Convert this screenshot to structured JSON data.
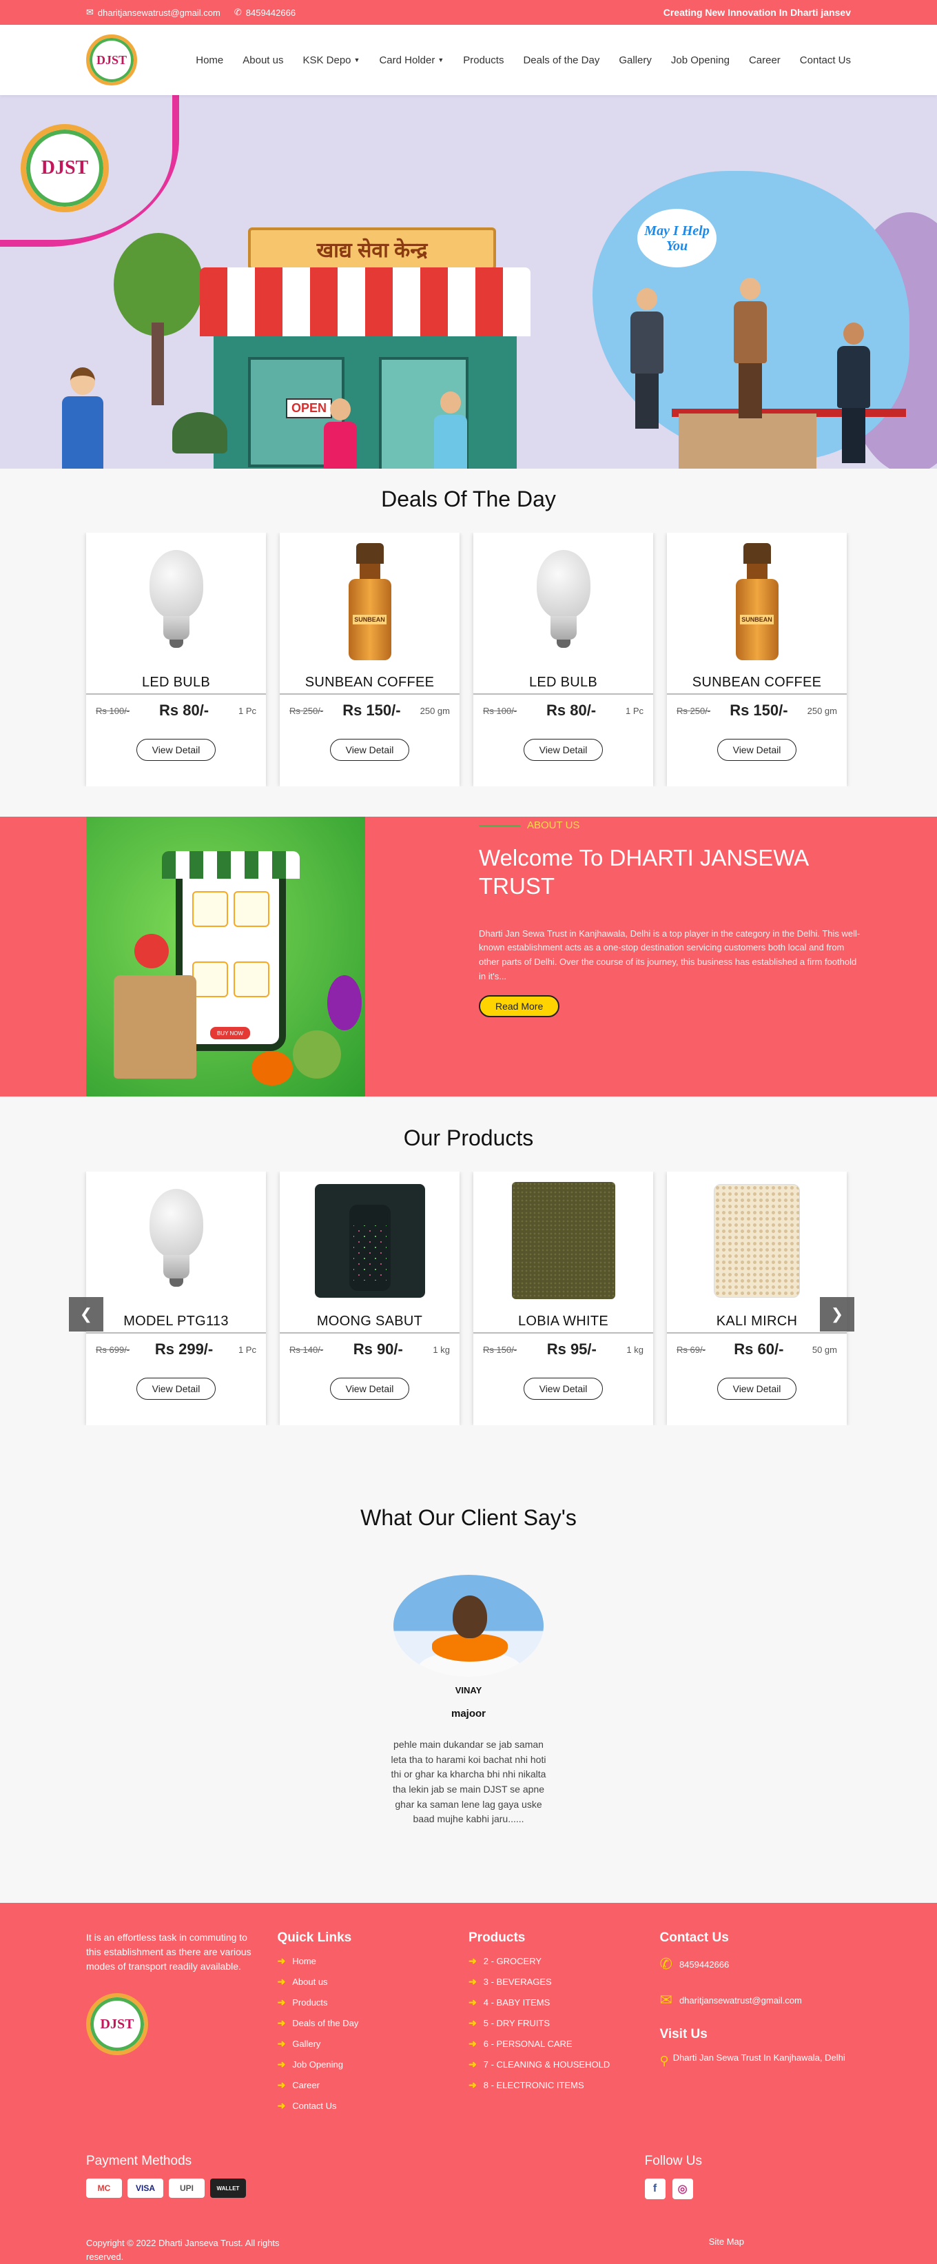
{
  "topbar": {
    "email": "dharitjansewatrust@gmail.com",
    "phone": "8459442666",
    "marquee": "Creating New Innovation In Dharti jansev"
  },
  "brand": {
    "logo_text": "DJST"
  },
  "nav": {
    "items": [
      "Home",
      "About us",
      "KSK Depo",
      "Card Holder",
      "Products",
      "Deals of the Day",
      "Gallery",
      "Job Opening",
      "Career",
      "Contact Us"
    ]
  },
  "hero": {
    "logo_text": "DJST",
    "sign_text": "खाद्य सेवा केन्द्र",
    "bubble_text": "May I Help You",
    "open_sign": "OPEN"
  },
  "deals": {
    "title": "Deals Of The Day",
    "cards": [
      {
        "name": "LED BULB",
        "old_price": "Rs 100/-",
        "price": "Rs 80/-",
        "unit": "1 Pc",
        "button": "View Detail",
        "image": "bulb"
      },
      {
        "name": "SUNBEAN COFFEE",
        "old_price": "Rs 250/-",
        "price": "Rs 150/-",
        "unit": "250 gm",
        "button": "View Detail",
        "image": "bottle"
      },
      {
        "name": "LED BULB",
        "old_price": "Rs 100/-",
        "price": "Rs 80/-",
        "unit": "1 Pc",
        "button": "View Detail",
        "image": "bulb"
      },
      {
        "name": "SUNBEAN COFFEE",
        "old_price": "Rs 250/-",
        "price": "Rs 150/-",
        "unit": "250 gm",
        "button": "View Detail",
        "image": "bottle"
      }
    ]
  },
  "about": {
    "kicker": "ABOUT US",
    "heading": "Welcome To DHARTI JANSEWA TRUST",
    "body": "Dharti Jan Sewa Trust in Kanjhawala, Delhi is a top player in the category in the Delhi. This well-known establishment acts as a one-stop destination servicing customers both local and from other parts of Delhi. Over the course of its journey, this business has established a firm foothold in it's...",
    "button": "Read More",
    "promo_button": "BUY NOW"
  },
  "products": {
    "title": "Our Products",
    "prev_icon": "❮",
    "next_icon": "❯",
    "cards": [
      {
        "name": "MODEL PTG113",
        "old_price": "Rs 699/-",
        "price": "Rs 299/-",
        "unit": "1 Pc",
        "button": "View Detail",
        "image": "bulb"
      },
      {
        "name": "MOONG SABUT",
        "old_price": "Rs 140/-",
        "price": "Rs 90/-",
        "unit": "1 kg",
        "button": "View Detail",
        "image": "jar"
      },
      {
        "name": "LOBIA WHITE",
        "old_price": "Rs 150/-",
        "price": "Rs 95/-",
        "unit": "1 kg",
        "button": "View Detail",
        "image": "bag-green"
      },
      {
        "name": "KALI MIRCH",
        "old_price": "Rs 69/-",
        "price": "Rs 60/-",
        "unit": "50 gm",
        "button": "View Detail",
        "image": "bag-white"
      }
    ]
  },
  "testimonials": {
    "title": "What Our Client Say's",
    "name": "VINAY",
    "role": "majoor",
    "quote": "pehle main dukandar se jab saman leta tha to harami koi bachat nhi hoti thi or ghar ka kharcha bhi nhi nikalta tha lekin jab se main DJST se apne ghar ka saman lene lag gaya uske baad mujhe kabhi jaru......"
  },
  "footer": {
    "about": "It is an effortless task in commuting to this establishment as there are various modes of transport readily available.",
    "logo_text": "DJST",
    "quick_links_title": "Quick Links",
    "quick_links": [
      "Home",
      "About us",
      "Products",
      "Deals of the Day",
      "Gallery",
      "Job Opening",
      "Career",
      "Contact Us"
    ],
    "products_title": "Products",
    "products": [
      "2 - GROCERY",
      "3 - BEVERAGES",
      "4 - BABY ITEMS",
      "5 - DRY FRUITS",
      "6 - PERSONAL CARE",
      "7 - CLEANING & HOUSEHOLD",
      "8 - ELECTRONIC ITEMS"
    ],
    "contact_title": "Contact Us",
    "phone": "8459442666",
    "email": "dharitjansewatrust@gmail.com",
    "visit_title": "Visit Us",
    "address": "Dharti Jan Sewa Trust In Kanjhawala, Delhi",
    "payment_title": "Payment Methods",
    "payments": [
      "MC",
      "VISA",
      "UPI",
      "WALLET"
    ],
    "follow_title": "Follow Us",
    "copyright": "Copyright © 2022 Dharti Janseva Trust. All rights reserved.",
    "sitemap": "Site Map"
  },
  "colors": {
    "brand_coral": "#f95f67",
    "accent_yellow": "#ffd400",
    "link_green": "#4caf50"
  },
  "icons": {
    "email": "envelope-icon",
    "phone": "phone-icon",
    "arrow": "arrow-right-icon",
    "pin": "map-pin-icon"
  }
}
